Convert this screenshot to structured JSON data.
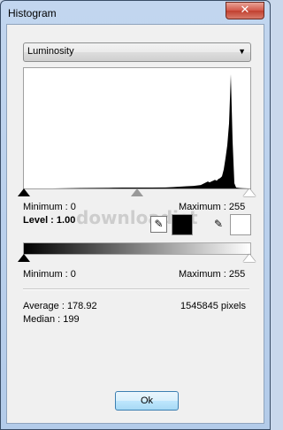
{
  "window": {
    "title": "Histogram",
    "close_glyph": "✕"
  },
  "channel_select": {
    "value": "Luminosity",
    "icon": "chevron-down-icon"
  },
  "input_levels": {
    "min_label": "Minimum : 0",
    "max_label": "Maximum : 255",
    "level_label": "Level : 1.00",
    "gamma": 1.0,
    "black_point": 0,
    "white_point": 255
  },
  "tools": {
    "gray_eyedropper_icon": "eyedropper-icon",
    "white_eyedropper_icon": "eyedropper-icon",
    "black_swatch_color": "#000000",
    "white_swatch_color": "#ffffff"
  },
  "output_levels": {
    "min_label": "Minimum : 0",
    "max_label": "Maximum : 255",
    "min": 0,
    "max": 255
  },
  "stats": {
    "average_label": "Average : 178.92",
    "median_label": "Median : 199",
    "pixels_label": "1545845 pixels"
  },
  "watermark": "downloadist",
  "buttons": {
    "ok": "Ok"
  },
  "chart_data": {
    "type": "area",
    "x": [
      0,
      32,
      64,
      96,
      112,
      128,
      144,
      160,
      168,
      176,
      184,
      192,
      196,
      200,
      202,
      204,
      206,
      208,
      210,
      212,
      214,
      216,
      218,
      220,
      222,
      224,
      226,
      228,
      230,
      232,
      234,
      236,
      238,
      240,
      244,
      248,
      255
    ],
    "values": [
      0,
      0,
      0.5,
      0.8,
      1,
      1,
      1,
      1.2,
      1.5,
      2,
      2.5,
      3,
      3.5,
      4,
      5,
      6,
      7,
      8,
      7,
      8,
      9,
      10,
      9,
      11,
      12,
      14,
      22,
      35,
      50,
      75,
      132,
      55,
      6,
      1,
      0.5,
      0.2,
      0
    ],
    "xlim": [
      0,
      255
    ],
    "ylim": [
      0,
      135
    ]
  }
}
